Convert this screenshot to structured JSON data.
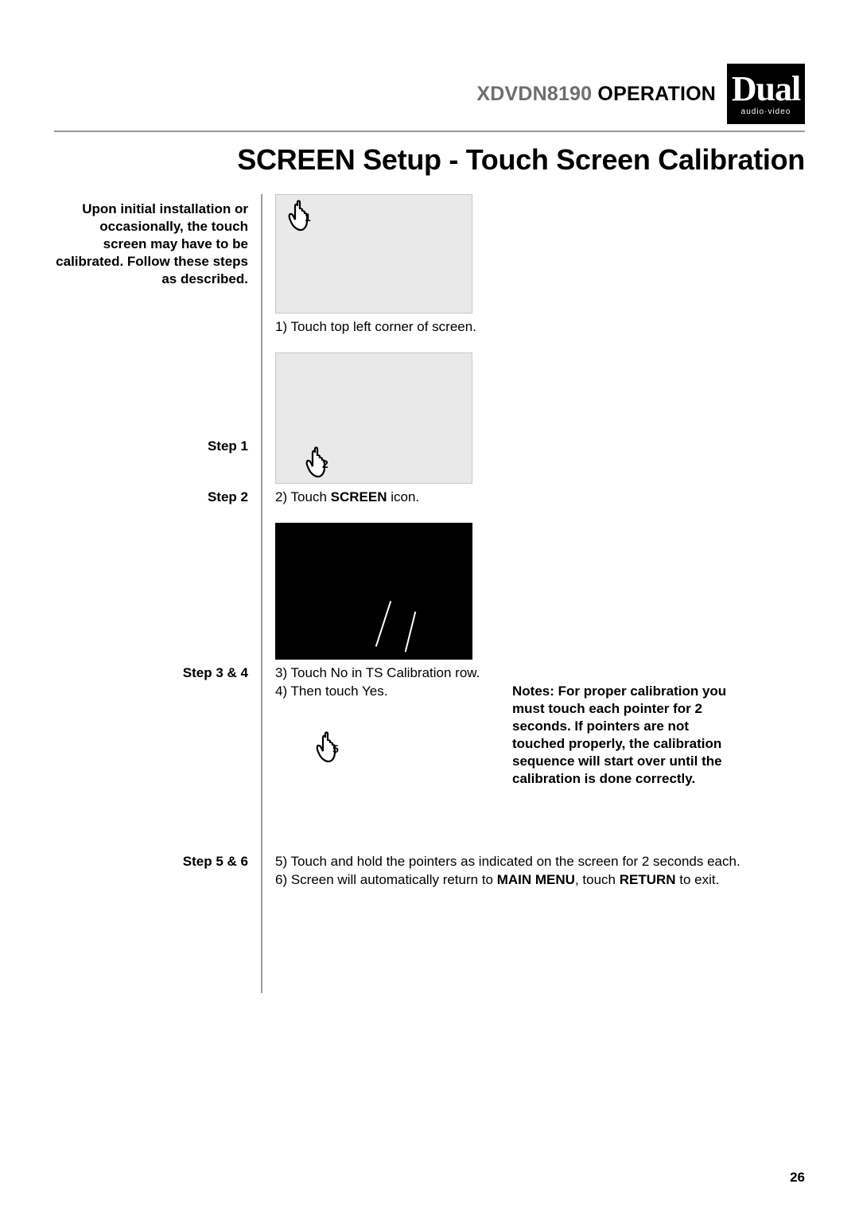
{
  "header": {
    "model": "XDVDN8190",
    "section": "OPERATION",
    "brand": "Dual",
    "brand_sub": "audio·video"
  },
  "title": "SCREEN Setup - Touch Screen Calibration",
  "intro": "Upon initial installation or occasionally, the touch screen may have to be calibrated. Follow these steps as described.",
  "steps": {
    "s1": {
      "label": "Step 1",
      "text": "1) Touch top left corner of screen.",
      "hand_num": "1"
    },
    "s2": {
      "label": "Step 2",
      "text_a": "2) Touch ",
      "bold": "SCREEN",
      "text_b": " icon.",
      "hand_num": "2"
    },
    "s34": {
      "label": "Step 3 & 4",
      "line1": "3) Touch No in TS Calibration row.",
      "line2": "4) Then touch Yes."
    },
    "s56": {
      "label": "Step 5 & 6",
      "hand_num": "5",
      "line1": "5) Touch and hold the pointers as indicated on the screen for 2 seconds each.",
      "line2_a": "6) Screen will automatically return to ",
      "line2_bold1": "MAIN MENU",
      "line2_mid": ", touch ",
      "line2_bold2": "RETURN",
      "line2_b": " to exit."
    }
  },
  "notes": "Notes: For proper calibration you must touch each pointer for 2 seconds. If pointers are not touched properly, the calibration sequence will start over until the calibration is done correctly.",
  "page_number": "26"
}
